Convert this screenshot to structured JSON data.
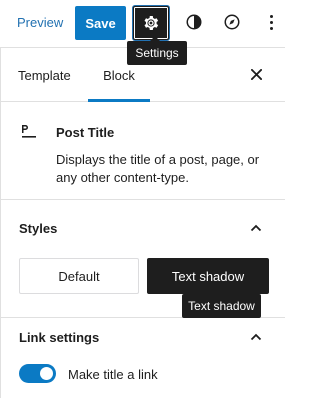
{
  "header": {
    "preview_label": "Preview",
    "save_label": "Save",
    "settings_tooltip": "Settings",
    "accent": "#0b7ac4"
  },
  "tabs": [
    {
      "label": "Template",
      "active": false
    },
    {
      "label": "Block",
      "active": true
    }
  ],
  "block": {
    "title": "Post Title",
    "description": "Displays the title of a post, page, or any other content-type.",
    "icon": "post-title-icon"
  },
  "styles": {
    "title": "Styles",
    "options": [
      {
        "label": "Default",
        "selected": false
      },
      {
        "label": "Text shadow",
        "selected": true
      }
    ],
    "hover_tooltip": "Text shadow"
  },
  "link_settings": {
    "title": "Link settings",
    "toggle_label": "Make title a link",
    "toggle_on": true
  }
}
